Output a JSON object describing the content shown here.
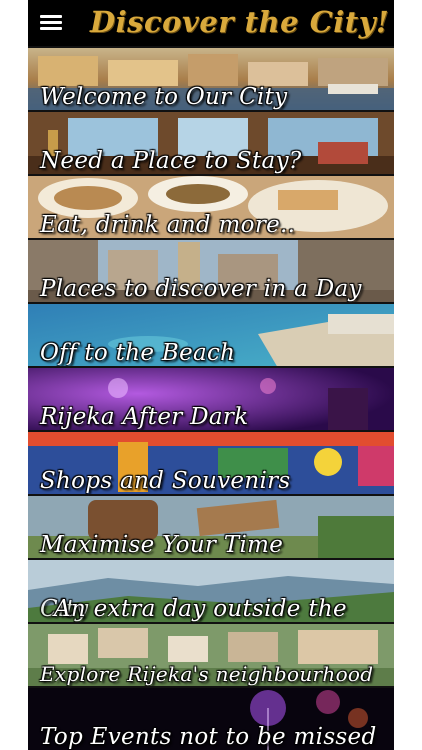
{
  "header": {
    "title": "Discover the City!",
    "menu_icon": "hamburger-menu-icon"
  },
  "tiles": [
    {
      "label": "Welcome to Our City",
      "theme": "harbor-town"
    },
    {
      "label": "Need a Place to Stay?",
      "theme": "hotel-room"
    },
    {
      "label": "Eat, drink and more..",
      "theme": "food-plates"
    },
    {
      "label": "Places to discover in a Day",
      "theme": "old-street"
    },
    {
      "label": "Off to the Beach",
      "theme": "sea-coast"
    },
    {
      "label": "Rijeka After Dark",
      "theme": "night-club"
    },
    {
      "label": "Shops and Souvenirs",
      "theme": "colorful-wall"
    },
    {
      "label": "Maximise Your Time",
      "theme": "wine-barrel"
    },
    {
      "label": "An extra day outside the",
      "label_behind": "City",
      "theme": "hills-view"
    },
    {
      "label": "Explore Rijeka's neighbourhood",
      "theme": "hillside-village"
    },
    {
      "label": "Top Events not to be missed",
      "theme": "fireworks"
    }
  ],
  "colors": {
    "title_gold": "#d9a93c",
    "background": "#000000"
  }
}
